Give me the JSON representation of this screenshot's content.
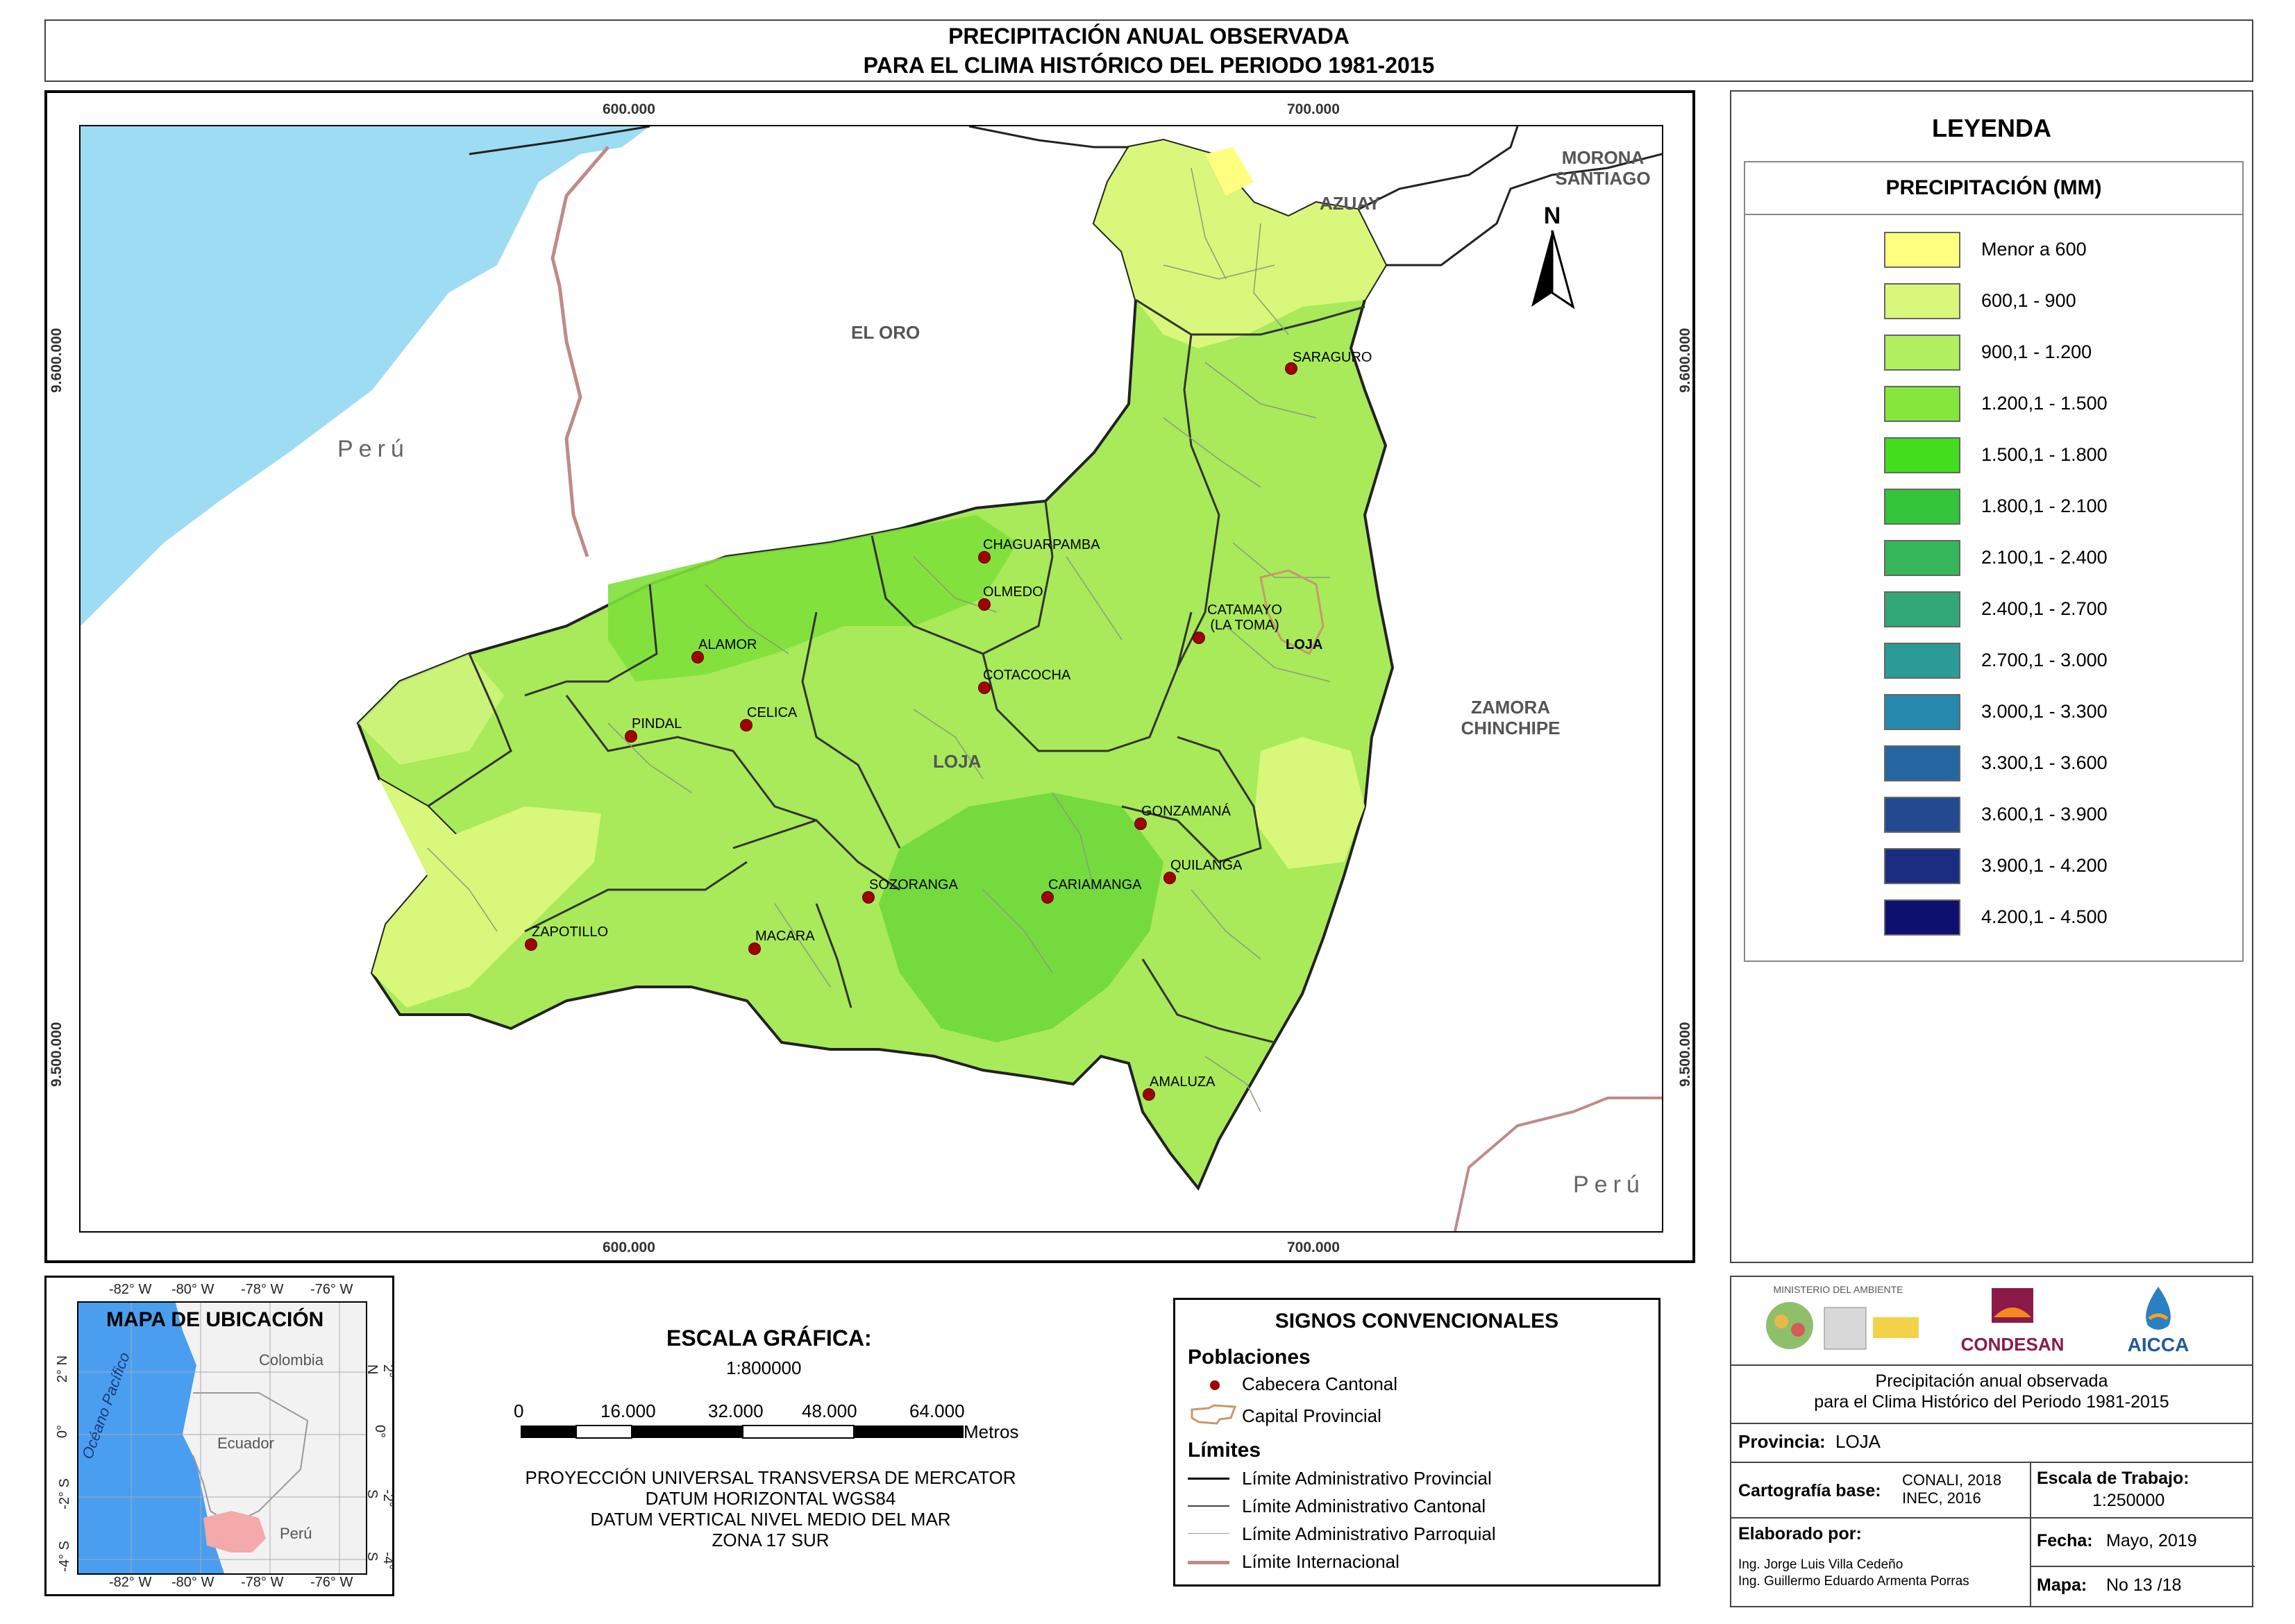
{
  "title": {
    "line1": "PRECIPITACIÓN ANUAL OBSERVADA",
    "line2": "PARA EL CLIMA HISTÓRICO DEL PERIODO 1981-2015"
  },
  "map": {
    "easting_labels": [
      "600.000",
      "700.000"
    ],
    "northing_labels": [
      "9.600.000",
      "9.500.000"
    ],
    "regions": {
      "el_oro": "EL ORO",
      "peru_w": "Perú",
      "azuay": "AZUAY",
      "morona": "MORONA SANTIAGO",
      "zamora": "ZAMORA CHINCHIPE",
      "loja_prov": "LOJA",
      "peru_se": "Perú",
      "loja_capital": "LOJA"
    },
    "cities": [
      {
        "name": "SARAGURO"
      },
      {
        "name": "CHAGUARPAMBA"
      },
      {
        "name": "OLMEDO"
      },
      {
        "name": "CATAMAYO (LA TOMA)"
      },
      {
        "name": "ALAMOR"
      },
      {
        "name": "COTACOCHA"
      },
      {
        "name": "PINDAL"
      },
      {
        "name": "CELICA"
      },
      {
        "name": "GONZAMANÁ"
      },
      {
        "name": "QUILANGA"
      },
      {
        "name": "SOZORANGA"
      },
      {
        "name": "CARIAMANGA"
      },
      {
        "name": "ZAPOTILLO"
      },
      {
        "name": "MACARA"
      },
      {
        "name": "AMALUZA"
      }
    ]
  },
  "legend": {
    "title": "LEYENDA",
    "subtitle": "PRECIPITACIÓN (MM)",
    "items": [
      {
        "label": "Menor a 600",
        "color": "#ffff80"
      },
      {
        "label": "600,1 - 900",
        "color": "#d9f77a"
      },
      {
        "label": "900,1 - 1.200",
        "color": "#b1ef5e"
      },
      {
        "label": "1.200,1 - 1.500",
        "color": "#85e63c"
      },
      {
        "label": "1.500,1 - 1.800",
        "color": "#44dd1e"
      },
      {
        "label": "1.800,1 - 2.100",
        "color": "#33c43a"
      },
      {
        "label": "2.100,1 - 2.400",
        "color": "#35b65a"
      },
      {
        "label": "2.400,1 - 2.700",
        "color": "#32a877"
      },
      {
        "label": "2.700,1 - 3.000",
        "color": "#2a9b96"
      },
      {
        "label": "3.000,1 - 3.300",
        "color": "#2489ad"
      },
      {
        "label": "3.300,1 - 3.600",
        "color": "#2366a0"
      },
      {
        "label": "3.600,1 - 3.900",
        "color": "#234a91"
      },
      {
        "label": "3.900,1 - 4.200",
        "color": "#1a2d80"
      },
      {
        "label": "4.200,1 - 4.500",
        "color": "#0e1070"
      }
    ]
  },
  "location_map": {
    "title": "MAPA DE UBICACIÓN",
    "lon_ticks": [
      "-82° W",
      "-80° W",
      "-78° W",
      "-76° W"
    ],
    "lat_ticks": [
      "2° N",
      "0°",
      "-2° S",
      "-4° S"
    ],
    "labels": {
      "colombia": "Colombia",
      "ecuador": "Ecuador",
      "peru": "Perú",
      "ocean": "Océano Pacífico"
    }
  },
  "scale": {
    "title": "ESCALA GRÁFICA:",
    "ratio": "1:800000",
    "ticks": [
      "0",
      "16.000",
      "32.000",
      "48.000",
      "64.000"
    ],
    "unit": "Metros",
    "projection": [
      "PROYECCIÓN UNIVERSAL TRANSVERSA DE MERCATOR",
      "DATUM HORIZONTAL WGS84",
      "DATUM VERTICAL NIVEL MEDIO DEL MAR",
      "ZONA 17 SUR"
    ]
  },
  "signs": {
    "title": "SIGNOS CONVENCIONALES",
    "poblaciones": "Poblaciones",
    "cabecera": "Cabecera Cantonal",
    "capital": "Capital Provincial",
    "limites": "Límites",
    "lim_prov": "Límite Administrativo Provincial",
    "lim_cant": "Límite Administrativo Cantonal",
    "lim_parr": "Límite Administrativo Parroquial",
    "lim_int": "Límite Internacional"
  },
  "info": {
    "logos": {
      "ministerio": "MINISTERIO DEL AMBIENTE",
      "condesan": "CONDESAN",
      "aicca": "AICCA"
    },
    "desc1": "Precipitación anual observada",
    "desc2": "para el Clima Histórico del Periodo 1981-2015",
    "provincia_label": "Provincia:",
    "provincia_value": "LOJA",
    "carto_label": "Cartografía base:",
    "carto_value1": "CONALI, 2018",
    "carto_value2": "INEC, 2016",
    "escala_label": "Escala de Trabajo:",
    "escala_value": "1:250000",
    "elaborado_label": "Elaborado por:",
    "autor1": "Ing. Jorge Luis Villa Cedeño",
    "autor2": "Ing. Guillermo Eduardo Armenta Porras",
    "fecha_label": "Fecha:",
    "fecha_value": "Mayo, 2019",
    "mapa_label": "Mapa:",
    "mapa_value": "No 13 /18"
  }
}
